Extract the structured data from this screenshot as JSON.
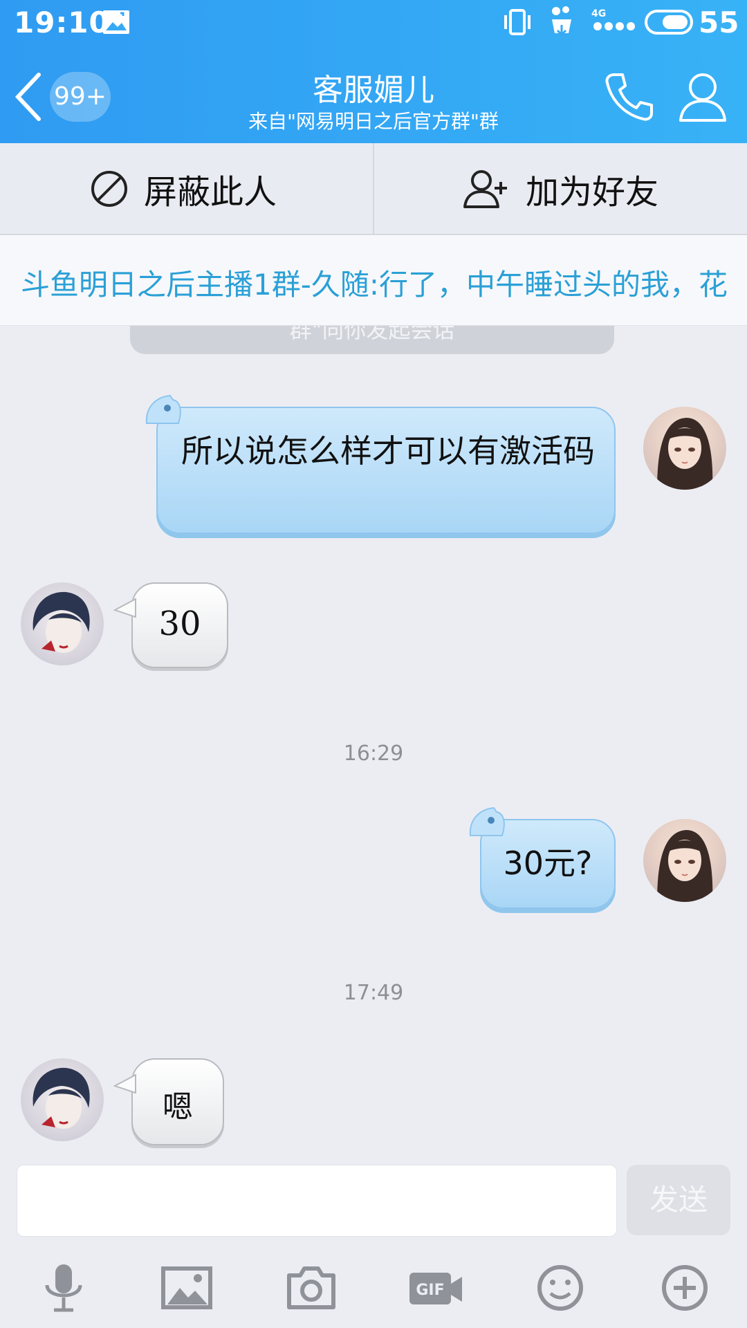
{
  "status_bar": {
    "time": "19:10",
    "network": "4G",
    "battery": "55"
  },
  "header": {
    "badge": "99+",
    "title": "客服媚儿",
    "subtitle": "来自\"网易明日之后官方群\"群"
  },
  "actions": {
    "block_label": "屏蔽此人",
    "add_friend_label": "加为好友"
  },
  "announcement": {
    "text": "斗鱼明日之后主播1群-久随:行了，中午睡过头的我，花",
    "system_notice": "群\"向你发起会话"
  },
  "messages": [
    {
      "sender": "me",
      "text": "所以说怎么样才可以有激活码"
    },
    {
      "sender": "other",
      "text": "30"
    },
    {
      "timestamp": "16:29"
    },
    {
      "sender": "me",
      "text": "30元?"
    },
    {
      "timestamp": "17:49"
    },
    {
      "sender": "other",
      "text": "嗯"
    }
  ],
  "input": {
    "placeholder": "",
    "send_label": "发送"
  },
  "toolbar": {
    "icons": [
      "microphone-icon",
      "image-icon",
      "camera-icon",
      "gif-icon",
      "emoji-icon",
      "plus-icon"
    ]
  },
  "colors": {
    "header_blue": "#2f9bf2",
    "announcement_text": "#2aa0d6",
    "my_bubble": "#a9d6f6"
  }
}
